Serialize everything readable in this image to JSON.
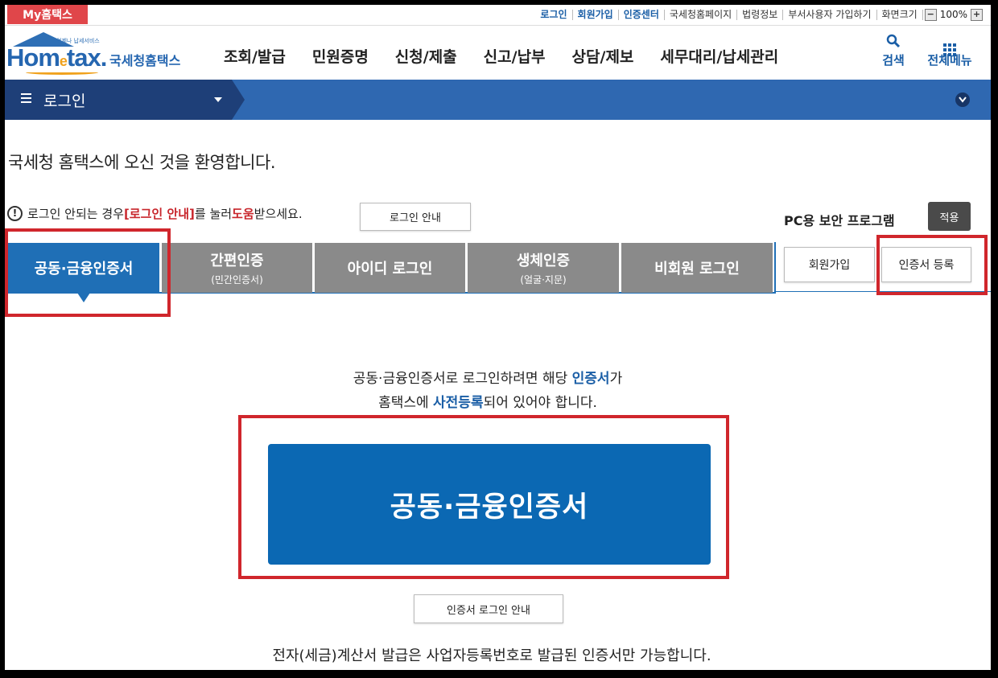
{
  "util": {
    "my_tab": "My홈택스",
    "links": [
      {
        "label": "로그인",
        "blue": true
      },
      {
        "label": "회원가입",
        "blue": true
      },
      {
        "label": "인증센터",
        "blue": true
      },
      {
        "label": "국세청홈페이지",
        "blue": false
      },
      {
        "label": "법령정보",
        "blue": false
      },
      {
        "label": "부서사용자 가입하기",
        "blue": false
      },
      {
        "label": "화면크기",
        "blue": false
      }
    ],
    "zoom_minus": "−",
    "zoom_value": "100%",
    "zoom_plus": "+"
  },
  "header": {
    "logo_tagline": "언제나 납세서비스",
    "logo_home": "Hom",
    "logo_e": "e",
    "logo_tax": "tax.",
    "logo_korean": "국세청홈택스",
    "menu": [
      "조회/발급",
      "민원증명",
      "신청/제출",
      "신고/납부",
      "상담/제보",
      "세무대리/납세관리"
    ],
    "search_label": "검색",
    "all_menu_label": "전체메뉴"
  },
  "bar": {
    "crumb": "로그인"
  },
  "welcome": "국세청 홈택스에 오신 것을 환영합니다.",
  "notice": {
    "part1": "로그인 안되는 경우 ",
    "highlight1": "[로그인 안내]",
    "part2": "를 눌러 ",
    "highlight2": "도움",
    "part3": "받으세요.",
    "guide_button": "로그인 안내"
  },
  "security": {
    "label": "PC용 보안 프로그램",
    "apply_button": "적용"
  },
  "tabs": [
    {
      "label": "공동·금융인증서",
      "sub": "",
      "active": true
    },
    {
      "label": "간편인증",
      "sub": "(민간인증서)",
      "active": false
    },
    {
      "label": "아이디 로그인",
      "sub": "",
      "active": false
    },
    {
      "label": "생체인증",
      "sub": "(얼굴·지문)",
      "active": false
    },
    {
      "label": "비회원 로그인",
      "sub": "",
      "active": false
    }
  ],
  "side_buttons": {
    "signup": "회원가입",
    "cert_register": "인증서 등록"
  },
  "content": {
    "line1_a": "공동·금융인증서로 로그인하려면 해당 ",
    "line1_b": "인증서",
    "line1_c": "가",
    "line2_a": "홈택스에 ",
    "line2_b": "사전등록",
    "line2_c": "되어 있어야 합니다.",
    "big_button": "공동·금융인증서",
    "cert_guide_button": "인증서 로그인 안내",
    "footer_note": "전자(세금)계산서 발급은 사업자등록번호로 발급된 인증서만 가능합니다."
  },
  "colors": {
    "primary": "#1f6fb6",
    "highlight": "#d0262c",
    "tab_inactive": "#8a8a8a"
  }
}
